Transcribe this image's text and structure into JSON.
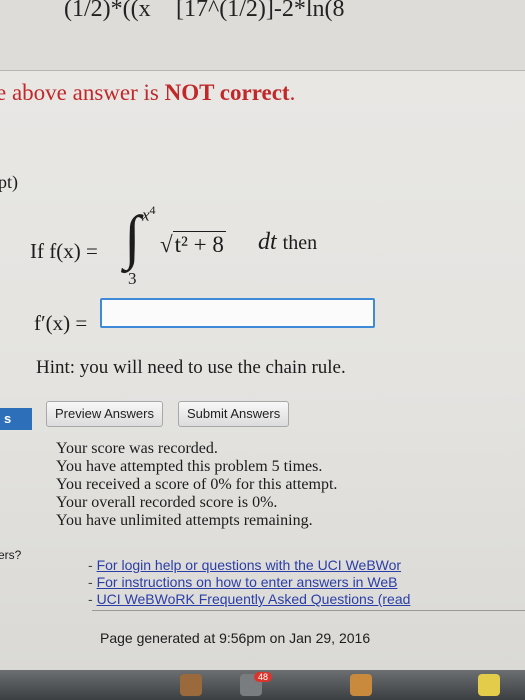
{
  "previous_answer": {
    "part_a": "(1/2)*((x",
    "part_b": "[17^(1/2)]-2*ln(8"
  },
  "feedback": {
    "prefix": "e above answer is ",
    "emphasis": "NOT correct",
    "suffix": "."
  },
  "problem": {
    "points": "pt)",
    "if_text": "If f(x) =",
    "integral_symbol": "∫",
    "upper_limit_var": "x",
    "upper_limit_exp": "4",
    "lower_limit": "3",
    "radicand": "t² + 8",
    "dt": "dt",
    "then": "then",
    "prompt": "f′(x) =",
    "answer_value": "",
    "hint": "Hint: you will need to use the chain rule."
  },
  "buttons": {
    "tab_fragment": "s",
    "preview": "Preview Answers",
    "submit": "Submit Answers"
  },
  "score_messages": [
    "Your score was recorded.",
    "You have attempted this problem 5 times.",
    "You received a score of 0% for this attempt.",
    "Your overall recorded score is 0%.",
    "You have unlimited attempts remaining."
  ],
  "sidebar_fragment": "ers?",
  "links": {
    "dash": "-",
    "login_help": "For login help or questions with the UCI WeBWor",
    "instructions": "For instructions on how to enter answers in WeB",
    "faq": "UCI WeBWoRK Frequently Asked Questions (read"
  },
  "footer": {
    "generated": "Page generated at 9:56pm on Jan 29, 2016"
  },
  "taskbar": {
    "badge": "48"
  },
  "colors": {
    "error_red": "#c0282a",
    "input_border": "#3f8ad8",
    "link_blue": "#2b3ea8",
    "tab_blue": "#2d6fb8"
  }
}
